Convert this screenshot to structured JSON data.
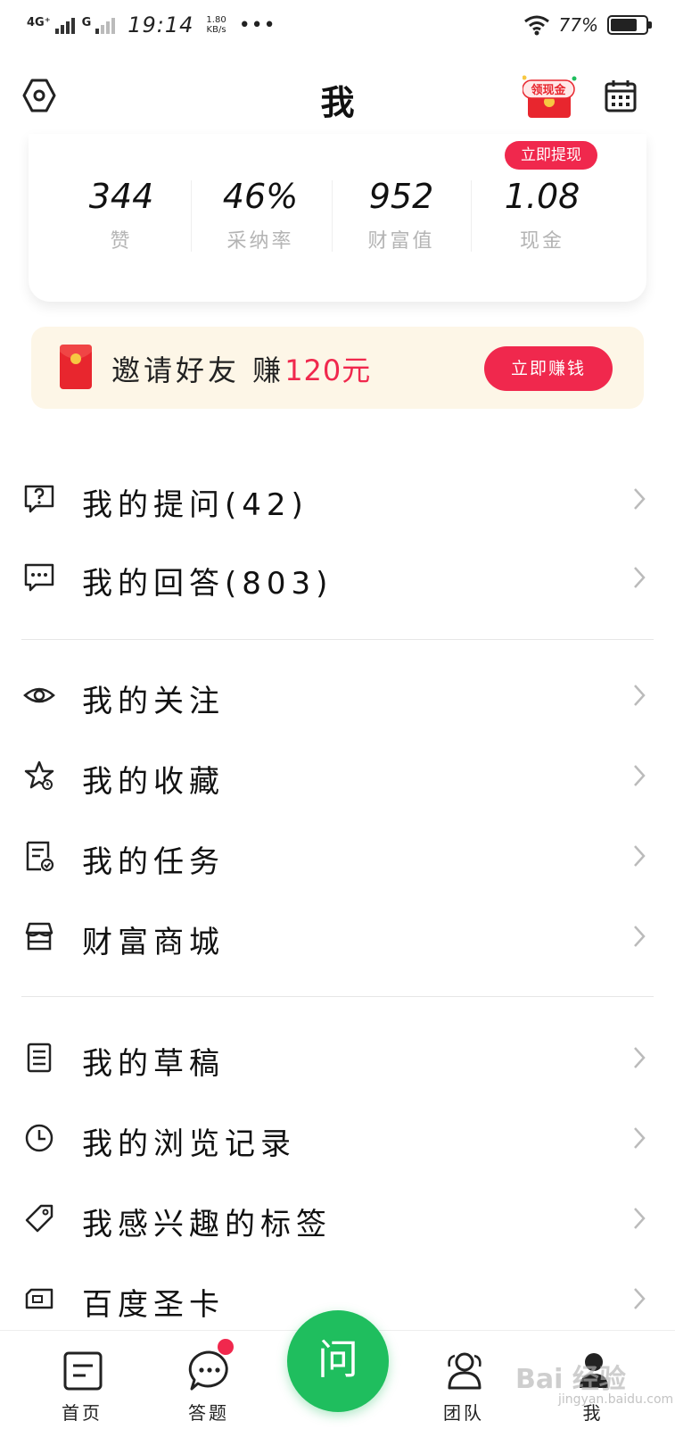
{
  "status_bar": {
    "network": "4G⁺",
    "network2": "G",
    "time": "19:14",
    "speed_value": "1.80",
    "speed_unit": "KB/s",
    "dots": "•••",
    "battery": "77%",
    "battery_level": 0.77
  },
  "header": {
    "title": "我",
    "cash_badge": "领现金"
  },
  "stats": {
    "withdraw_tag": "立即提现",
    "items": [
      {
        "value": "344",
        "label": "赞"
      },
      {
        "value": "46%",
        "label": "采纳率"
      },
      {
        "value": "952",
        "label": "财富值"
      },
      {
        "value": "1.08",
        "label": "现金"
      }
    ]
  },
  "invite": {
    "text": "邀请好友 赚",
    "amount": "120元",
    "button": "立即赚钱"
  },
  "menu": {
    "items": [
      {
        "label": "我的提问(42)",
        "icon": "question-icon"
      },
      {
        "label": "我的回答(803)",
        "icon": "answer-icon"
      },
      {
        "label": "我的关注",
        "icon": "eye-icon"
      },
      {
        "label": "我的收藏",
        "icon": "star-icon"
      },
      {
        "label": "我的任务",
        "icon": "task-icon"
      },
      {
        "label": "财富商城",
        "icon": "store-icon"
      },
      {
        "label": "我的草稿",
        "icon": "draft-icon"
      },
      {
        "label": "我的浏览记录",
        "icon": "clock-icon"
      },
      {
        "label": "我感兴趣的标签",
        "icon": "tag-icon"
      },
      {
        "label": "百度圣卡",
        "icon": "sim-card-icon"
      }
    ]
  },
  "tabbar": {
    "items": [
      {
        "label": "首页",
        "icon": "home-icon"
      },
      {
        "label": "答题",
        "icon": "chat-icon"
      },
      {
        "label": "问",
        "icon": "ask-icon"
      },
      {
        "label": "团队",
        "icon": "team-icon"
      },
      {
        "label": "我",
        "icon": "profile-icon"
      }
    ]
  },
  "watermark": {
    "text": "Bai 经验",
    "sub": "jingyan.baidu.com"
  },
  "colors": {
    "accent_red": "#f0284d",
    "accent_green": "#1fbe5e",
    "banner_bg": "#fdf6e7"
  }
}
